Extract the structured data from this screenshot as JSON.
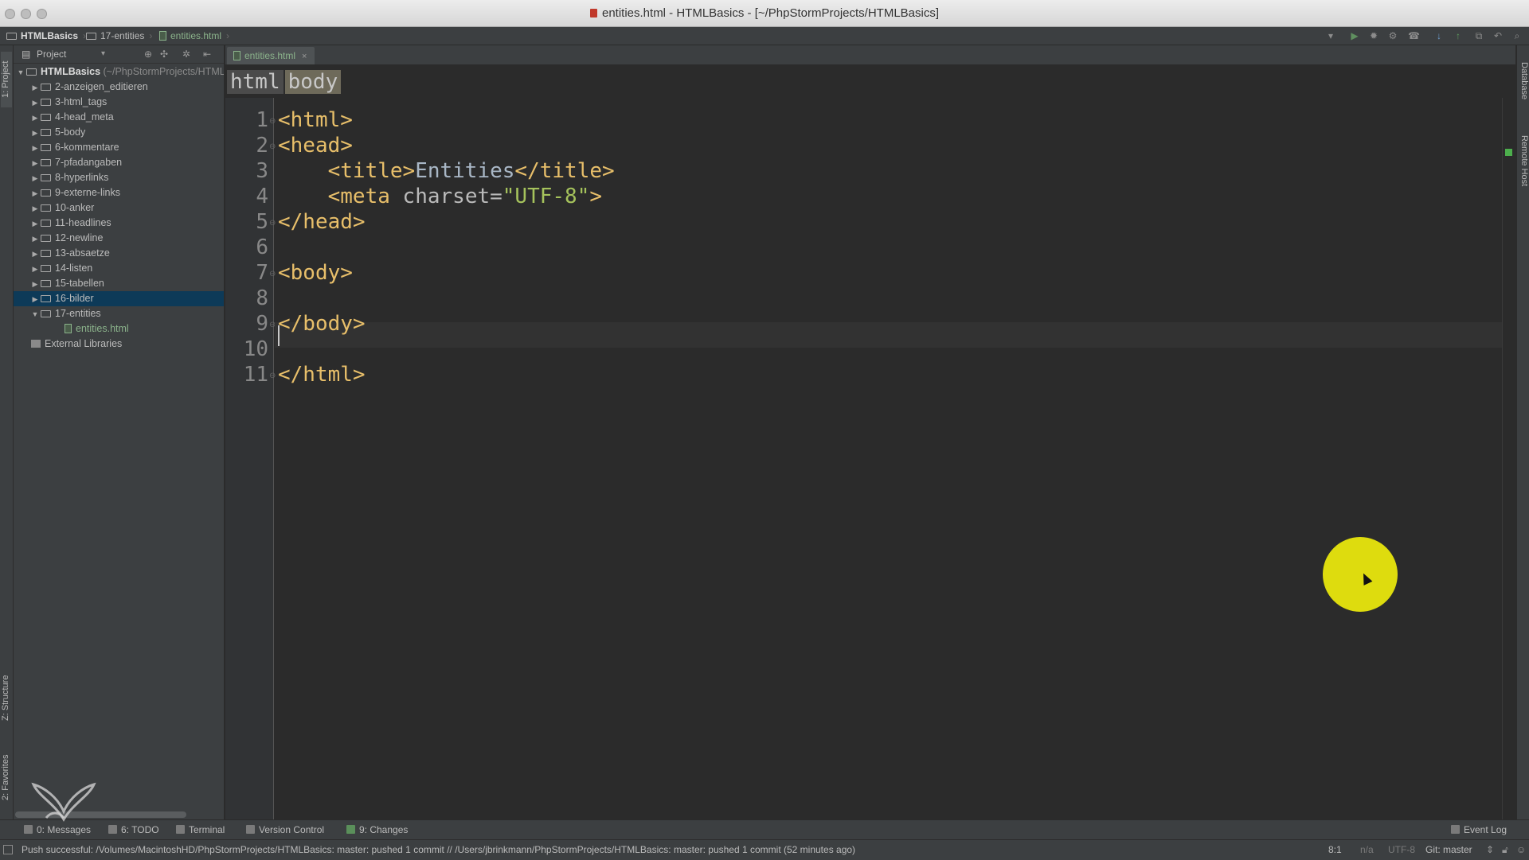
{
  "window": {
    "title": "entities.html - HTMLBasics - [~/PhpStormProjects/HTMLBasics]"
  },
  "navbar": {
    "crumbs": [
      "HTMLBasics",
      "17-entities",
      "entities.html"
    ]
  },
  "left_strip": {
    "project_tab": "1: Project",
    "structure_tab": "Z: Structure",
    "favorites_tab": "2: Favorites"
  },
  "right_strip": {
    "database_tab": "Database",
    "remote_host_tab": "Remote Host"
  },
  "project_panel": {
    "view_selector": "Project",
    "root": {
      "name": "HTMLBasics",
      "path": "(~/PhpStormProjects/HTMLBasics)"
    },
    "folders": [
      "2-anzeigen_editieren",
      "3-html_tags",
      "4-head_meta",
      "5-body",
      "6-kommentare",
      "7-pfadangaben",
      "8-hyperlinks",
      "9-externe-links",
      "10-anker",
      "11-headlines",
      "12-newline",
      "13-absaetze",
      "14-listen",
      "15-tabellen",
      "16-bilder",
      "17-entities"
    ],
    "selected_folder": "16-bilder",
    "open_file": "entities.html",
    "external_libraries": "External Libraries"
  },
  "editor": {
    "tab_label": "entities.html",
    "tag_breadcrumbs": [
      "html",
      "body"
    ],
    "line_numbers": [
      "1",
      "2",
      "3",
      "4",
      "5",
      "6",
      "7",
      "8",
      "9",
      "10",
      "11"
    ],
    "code": {
      "l1": "<html>",
      "l2": "<head>",
      "l3_open": "    <title>",
      "l3_text": "Entities",
      "l3_close": "</title>",
      "l4_open": "    <meta ",
      "l4_attr": "charset=",
      "l4_val": "\"UTF-8\"",
      "l4_close": ">",
      "l5": "</head>",
      "l7": "<body>",
      "l9": "</body>",
      "l11": "</html>"
    }
  },
  "tool_windows": {
    "messages": "0: Messages",
    "todo": "6: TODO",
    "terminal": "Terminal",
    "version_control": "Version Control",
    "changes": "9: Changes",
    "event_log": "Event Log"
  },
  "status": {
    "message": "Push successful: /Volumes/MacintoshHD/PhpStormProjects/HTMLBasics: master: pushed 1 commit // /Users/jbrinkmann/PhpStormProjects/HTMLBasics: master: pushed 1 commit (52 minutes ago)",
    "position": "8:1",
    "line_sep": "n/a",
    "encoding": "UTF-8",
    "vcs_branch": "Git: master"
  },
  "colors": {
    "editor_bg": "#2b2b2b",
    "tag": "#e8bf6a",
    "string": "#a5c25c",
    "selection": "#0d3a58",
    "cursor_highlight": "#dedc0e"
  }
}
